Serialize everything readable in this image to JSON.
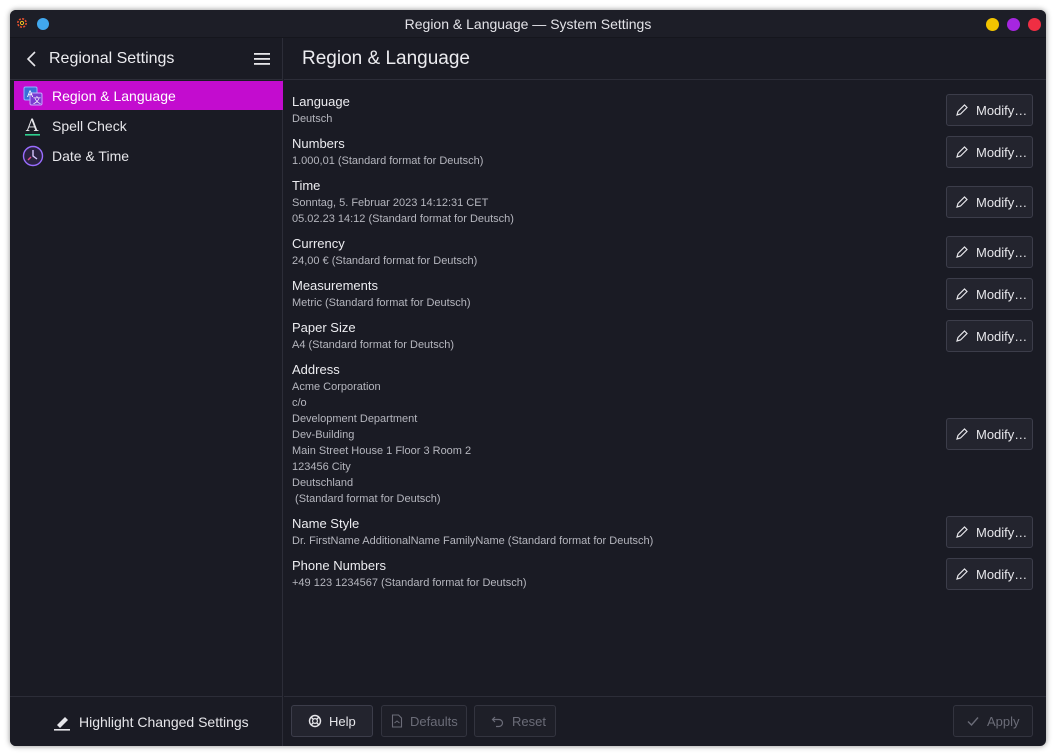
{
  "window": {
    "title": "Region & Language — System Settings",
    "controls": [
      {
        "name": "minimize",
        "color": "#f2c400"
      },
      {
        "name": "maximize",
        "color": "#a626e0"
      },
      {
        "name": "close",
        "color": "#ef2e43"
      }
    ]
  },
  "sidebar": {
    "title": "Regional Settings",
    "items": [
      {
        "label": "Region & Language",
        "icon": "region-language-icon",
        "active": true
      },
      {
        "label": "Spell Check",
        "icon": "spell-check-icon",
        "active": false
      },
      {
        "label": "Date & Time",
        "icon": "date-time-icon",
        "active": false
      }
    ],
    "highlight_label": "Highlight Changed Settings"
  },
  "main": {
    "title": "Region & Language",
    "modify_label": "Modify…",
    "settings": [
      {
        "label": "Language",
        "lines": [
          "Deutsch"
        ]
      },
      {
        "label": "Numbers",
        "lines": [
          "1.000,01 (Standard format for Deutsch)"
        ]
      },
      {
        "label": "Time",
        "lines": [
          "Sonntag, 5. Februar 2023 14:12:31 CET",
          "05.02.23 14:12 (Standard format for Deutsch)"
        ]
      },
      {
        "label": "Currency",
        "lines": [
          "24,00 € (Standard format for Deutsch)"
        ]
      },
      {
        "label": "Measurements",
        "lines": [
          "Metric (Standard format for Deutsch)"
        ]
      },
      {
        "label": "Paper Size",
        "lines": [
          "A4 (Standard format for Deutsch)"
        ]
      },
      {
        "label": "Address",
        "lines": [
          "Acme Corporation",
          "c/o",
          "Development Department",
          "Dev-Building",
          "Main Street House 1 Floor 3 Room 2",
          "123456 City",
          "Deutschland",
          " (Standard format for Deutsch)"
        ]
      },
      {
        "label": "Name Style",
        "lines": [
          "Dr. FirstName AdditionalName FamilyName (Standard format for Deutsch)"
        ]
      },
      {
        "label": "Phone Numbers",
        "lines": [
          "+49 123 1234567 (Standard format for Deutsch)"
        ]
      }
    ]
  },
  "footer": {
    "help": "Help",
    "defaults": "Defaults",
    "reset": "Reset",
    "apply": "Apply"
  },
  "colors": {
    "accent": "#c30ccf",
    "background": "#1a1b24",
    "button": "#23242e"
  }
}
